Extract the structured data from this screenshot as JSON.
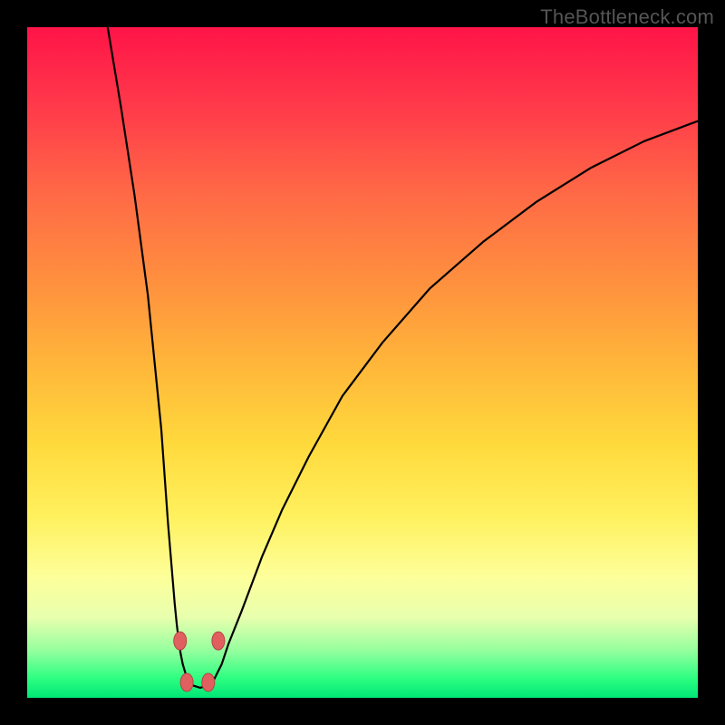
{
  "watermark": "TheBottleneck.com",
  "colors": {
    "frame_background": "#000000",
    "curve_stroke": "#000000",
    "marker_fill": "#e06060",
    "marker_stroke": "#b54444",
    "gradient_stops": [
      "#ff1448",
      "#ff3a4a",
      "#ff6a46",
      "#ff903e",
      "#ffb53a",
      "#ffd93c",
      "#fff15e",
      "#fdff9a",
      "#e8ffae",
      "#94ff9e",
      "#2fff82",
      "#00e676"
    ]
  },
  "chart_data": {
    "type": "line",
    "title": "",
    "xlabel": "",
    "ylabel": "",
    "xlim": [
      0,
      100
    ],
    "ylim": [
      0,
      100
    ],
    "grid": false,
    "legend": false,
    "series": [
      {
        "name": "left-curve",
        "x": [
          12,
          14,
          16,
          18,
          19,
          20,
          20.5,
          21,
          21.5,
          22,
          22.3,
          22.6,
          22.9,
          23.2,
          23.5,
          23.8,
          24.0,
          24.2
        ],
        "values": [
          100,
          88,
          75,
          60,
          50,
          40,
          33,
          26,
          20,
          14,
          11,
          8.5,
          6.5,
          5,
          4,
          3,
          2.3,
          2
        ]
      },
      {
        "name": "right-curve",
        "x": [
          27.5,
          28,
          29,
          30,
          32,
          35,
          38,
          42,
          47,
          53,
          60,
          68,
          76,
          84,
          92,
          100
        ],
        "values": [
          2,
          3,
          5,
          8,
          13,
          21,
          28,
          36,
          45,
          53,
          61,
          68,
          74,
          79,
          83,
          86
        ]
      },
      {
        "name": "floor",
        "x": [
          24.2,
          25.8,
          27.5
        ],
        "values": [
          2,
          1.5,
          2
        ]
      }
    ],
    "markers": [
      {
        "x": 22.8,
        "y": 8.5
      },
      {
        "x": 23.8,
        "y": 2.3
      },
      {
        "x": 27.0,
        "y": 2.3
      },
      {
        "x": 28.5,
        "y": 8.5
      }
    ]
  }
}
